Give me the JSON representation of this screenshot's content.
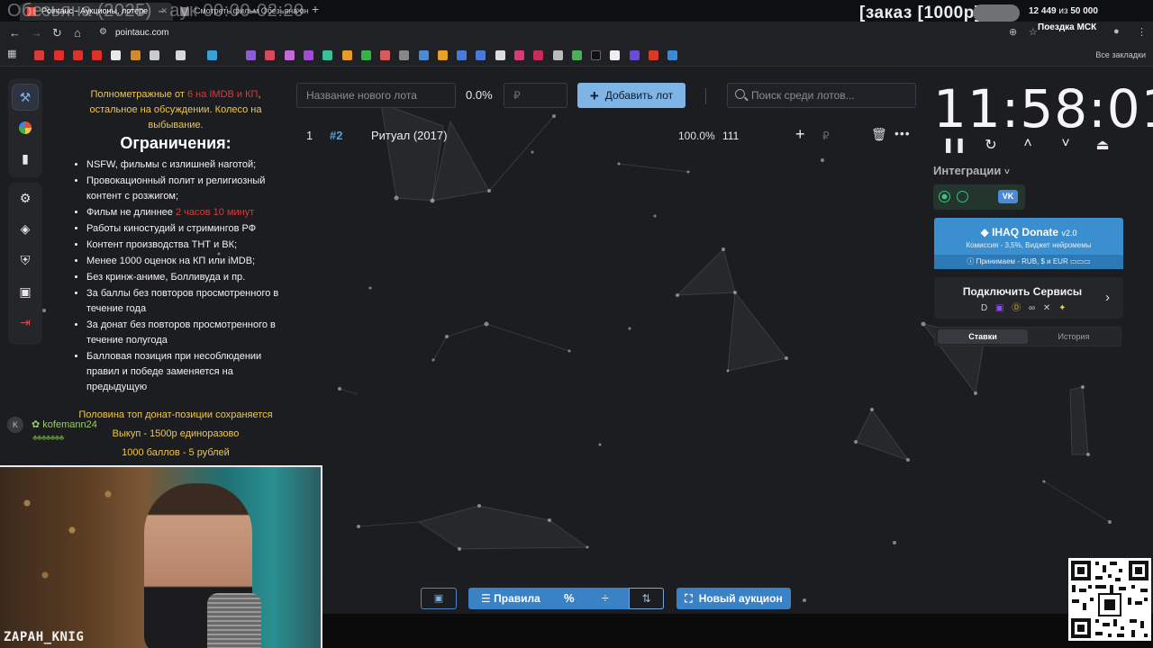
{
  "stream": {
    "title": "Обезьяна (2025) - аук 00:00-02:20",
    "order_label": "[заказ [1000р]",
    "goal_current": "12 449",
    "goal_sep": "из",
    "goal_total": "50 000",
    "trip_label": "Поездка МСК",
    "streamer_name": "ZAPAH_KNIG"
  },
  "browser": {
    "tabs": [
      {
        "label": "Pointauc - Аукционы, лотере"
      },
      {
        "label": "Смотреть фильм Обезьяна он"
      }
    ],
    "url": "pointauc.com",
    "bookmarks_all": "Все закладки"
  },
  "rules": {
    "intro_before": "Полнометражные от ",
    "intro_red": "6 на IMDB и КП",
    "intro_after": ", остальное на обсуждении. Колесо на выбывание.",
    "heading": "Ограничения:",
    "items": [
      "NSFW, фильмы с излишней наготой;",
      "Провокационный полит и религиозный контент с розжигом;",
      "Фильм не длиннее ",
      "Работы киностудий и стримингов РФ",
      "Контент производства ТНТ и ВК;",
      "Менее 1000 оценок на КП или iMDB;",
      "Без кринж-аниме, Болливуда и пр.",
      "За баллы без повторов просмотренного в течение года",
      "За донат без повторов просмотренного в течение полугода",
      "Балловая позиция при несоблюдении правил и победе заменяется на предыдущую"
    ],
    "duration_red": "2 часов 10 минут",
    "footer": [
      "Половина топ донат-позиции сохраняется",
      "Выкуп - 1500р единоразово",
      "1000 баллов - 5 рублей"
    ]
  },
  "chat": {
    "avatar_letter": "K",
    "username": "kofemann24"
  },
  "controls": {
    "lot_placeholder": "Название нового лота",
    "percent": "0.0%",
    "rub_placeholder": "₽",
    "add_lot": "Добавить лот",
    "search_placeholder": "Поиск среди лотов..."
  },
  "lots": [
    {
      "num": "1",
      "id": "#2",
      "title": "Ритуал (2017)",
      "pct": "100.0%",
      "amount": "111",
      "rub": "₽"
    }
  ],
  "timer": {
    "value": "11:58:01"
  },
  "integrations": {
    "label": "Интеграции",
    "vk": "VK"
  },
  "ihaq": {
    "title": "IHAQ Donate",
    "version": "v2.0",
    "subtitle": "Комиссия - 3,5%, Виджет нейромемы",
    "payments": "Принимаем - RUB, $ и EUR"
  },
  "services": {
    "label": "Подключить Сервисы"
  },
  "bets_tabs": {
    "bets": "Ставки",
    "history": "История"
  },
  "toolbar": {
    "rules": "Правила",
    "pct": "%",
    "new_auction": "Новый аукцион"
  },
  "colors": {
    "accent": "#3a82c6",
    "add_button": "#7fb4e6",
    "rule_intro": "#f0c64a",
    "warn": "#d83a3a",
    "ihaq": "#3b8fcf"
  }
}
